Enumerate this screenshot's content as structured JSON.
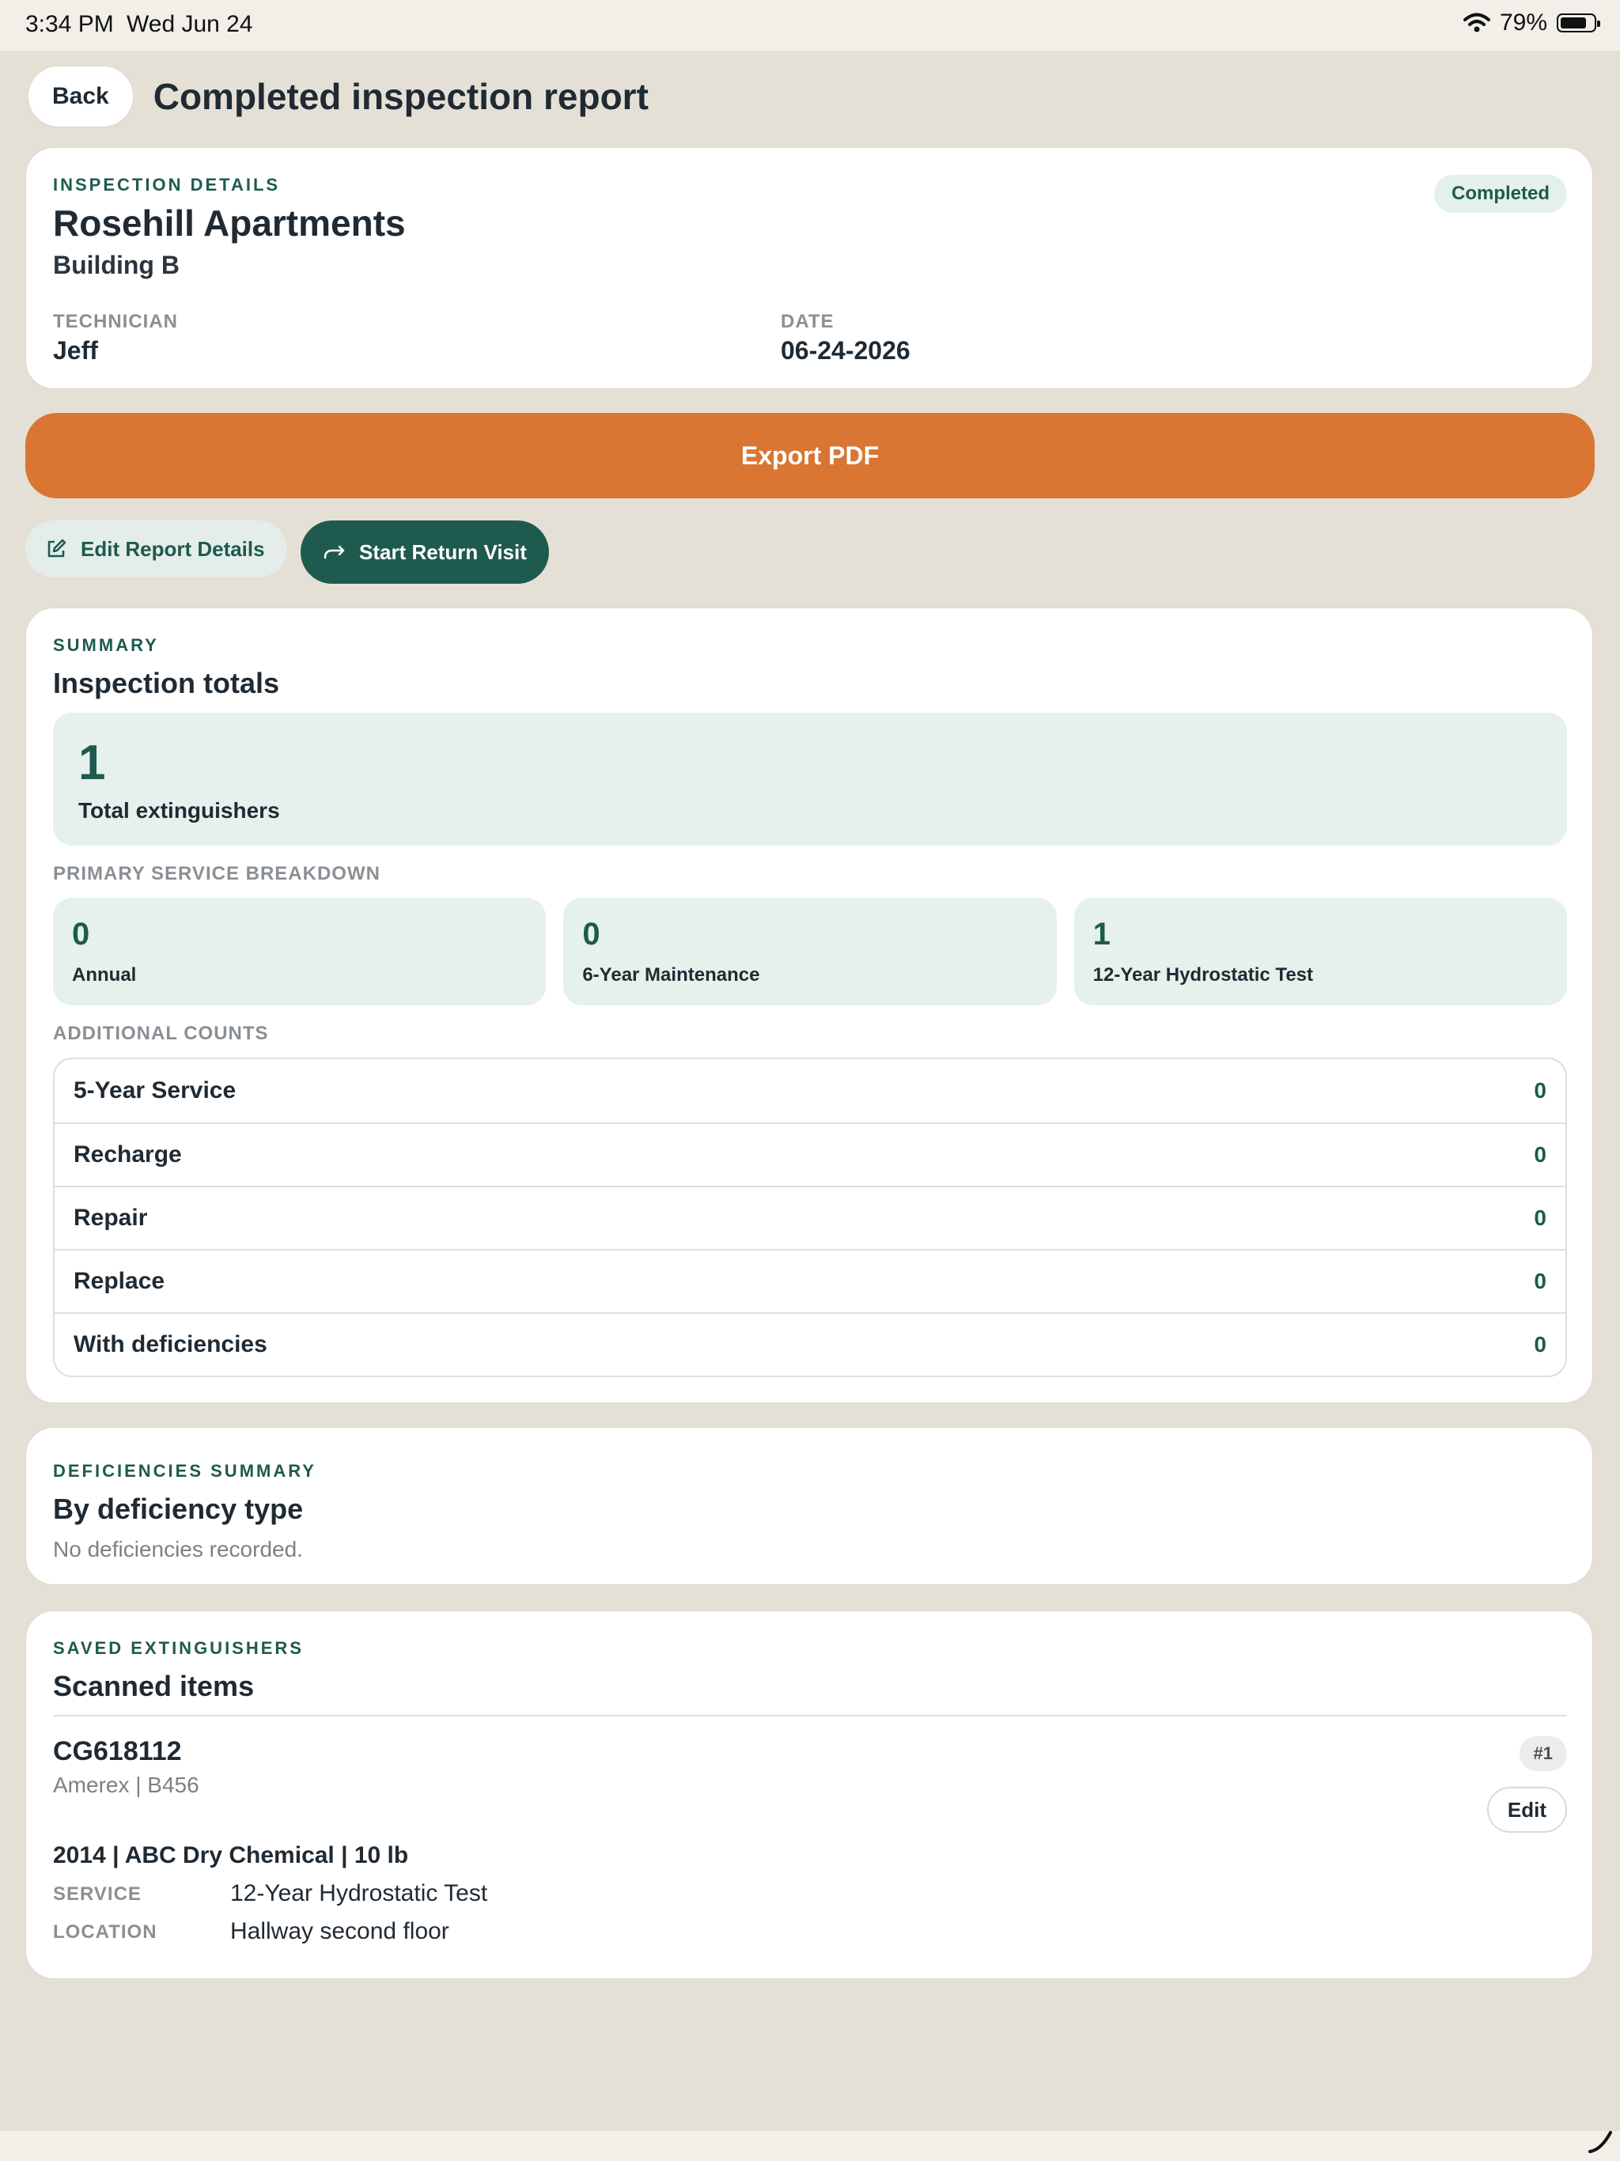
{
  "status_bar": {
    "time": "3:34 PM",
    "date": "Wed Jun 24",
    "battery": "79%",
    "battery_level": 0.79
  },
  "header": {
    "back_label": "Back",
    "title": "Completed inspection report"
  },
  "details": {
    "eyebrow": "INSPECTION DETAILS",
    "site": "Rosehill Apartments",
    "building": "Building B",
    "status": "Completed",
    "technician_label": "TECHNICIAN",
    "technician": "Jeff",
    "date_label": "DATE",
    "date": "06-24-2026"
  },
  "actions": {
    "export_label": "Export PDF",
    "edit_label": "Edit Report Details",
    "return_label": "Start Return Visit"
  },
  "summary": {
    "eyebrow": "SUMMARY",
    "heading": "Inspection totals",
    "total_value": "1",
    "total_label": "Total extinguishers",
    "breakdown_label": "PRIMARY SERVICE BREAKDOWN",
    "breakdown": [
      {
        "value": "0",
        "label": "Annual"
      },
      {
        "value": "0",
        "label": "6-Year Maintenance"
      },
      {
        "value": "1",
        "label": "12-Year Hydrostatic Test"
      }
    ],
    "additional_label": "ADDITIONAL COUNTS",
    "additional": [
      {
        "label": "5-Year Service",
        "value": "0"
      },
      {
        "label": "Recharge",
        "value": "0"
      },
      {
        "label": "Repair",
        "value": "0"
      },
      {
        "label": "Replace",
        "value": "0"
      },
      {
        "label": "With deficiencies",
        "value": "0"
      }
    ]
  },
  "deficiencies": {
    "eyebrow": "DEFICIENCIES SUMMARY",
    "heading": "By deficiency type",
    "empty": "No deficiencies recorded."
  },
  "saved": {
    "eyebrow": "SAVED EXTINGUISHERS",
    "heading": "Scanned items",
    "items": [
      {
        "serial": "CG618112",
        "make": "Amerex | B456",
        "index": "#1",
        "edit_label": "Edit",
        "specs": "2014 | ABC Dry Chemical | 10 lb",
        "service_label": "SERVICE",
        "service": "12-Year Hydrostatic Test",
        "location_label": "LOCATION",
        "location": "Hallway second floor"
      }
    ]
  },
  "colors": {
    "accent": "#1e5a4e",
    "export": "#d97634",
    "background": "#e5e0d6",
    "tile": "#e6f0ec"
  },
  "icons": [
    "wifi-icon",
    "battery-icon",
    "edit-icon",
    "return-arrow-icon"
  ]
}
